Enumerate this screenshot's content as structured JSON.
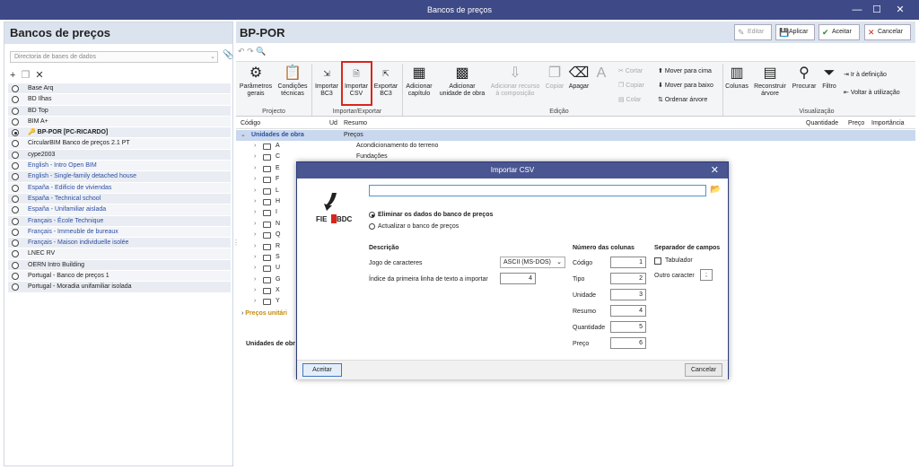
{
  "window": {
    "title": "Bancos de preços",
    "min_icon": "minimize-icon",
    "max_icon": "maximize-icon",
    "close_icon": "close-icon"
  },
  "left": {
    "title": "Bancos de preços",
    "dir_placeholder": "Directoria de bases de dados",
    "databases": [
      {
        "label": "Base Arq",
        "style": "normal",
        "selected": false
      },
      {
        "label": "BD Ilhas",
        "style": "normal",
        "selected": false
      },
      {
        "label": "BD Top",
        "style": "normal",
        "selected": false
      },
      {
        "label": "BIM A+",
        "style": "normal",
        "selected": false
      },
      {
        "label": "BP-POR [PC-RICARDO]",
        "style": "bold",
        "selected": true
      },
      {
        "label": "CircularBIM Banco de preços 2.1 PT",
        "style": "normal",
        "selected": false
      },
      {
        "label": "cype2003",
        "style": "normal",
        "selected": false
      },
      {
        "label": "English - Intro Open BIM",
        "style": "blue",
        "selected": false
      },
      {
        "label": "English - Single-family detached house",
        "style": "blue",
        "selected": false
      },
      {
        "label": "España - Edificio de viviendas",
        "style": "blue",
        "selected": false
      },
      {
        "label": "España - Technical school",
        "style": "blue",
        "selected": false
      },
      {
        "label": "España - Unifamiliar aislada",
        "style": "blue",
        "selected": false
      },
      {
        "label": "Français - École Technique",
        "style": "blue",
        "selected": false
      },
      {
        "label": "Français - Immeuble de bureaux",
        "style": "blue",
        "selected": false
      },
      {
        "label": "Français - Maison individuelle isolée",
        "style": "blue",
        "selected": false
      },
      {
        "label": "LNEC RV",
        "style": "normal",
        "selected": false
      },
      {
        "label": "OERN Intro Building",
        "style": "normal",
        "selected": false
      },
      {
        "label": "Portugal - Banco de preços 1",
        "style": "normal",
        "selected": false
      },
      {
        "label": "Portugal - Moradia unifamiliar isolada",
        "style": "normal",
        "selected": false
      }
    ]
  },
  "right": {
    "title": "BP-POR",
    "buttons": {
      "edit": "Editar",
      "apply": "Aplicar",
      "accept": "Aceitar",
      "cancel": "Cancelar"
    },
    "ribbon": {
      "params": "Parâmetros gerais",
      "conds": "Condições técnicas",
      "imp_bc3": "Importar BC3",
      "imp_csv": "Importar CSV",
      "exp_bc3": "Exportar BC3",
      "add_cap": "Adicionar capítulo",
      "add_unit": "Adicionar unidade de obra",
      "add_res": "Adicionar recurso à composição",
      "copy": "Copiar",
      "delete": "Apagar",
      "cut": "Cortar",
      "copy2": "Copiar",
      "paste": "Colar",
      "up": "Mover para cima",
      "down": "Mover para baixo",
      "sort": "Ordenar árvore",
      "cols": "Colunas",
      "rebuild": "Reconstruir árvore",
      "search": "Procurar",
      "filter": "Filtro",
      "goto": "Ir à definição",
      "back": "Voltar à utilização",
      "grp_proj": "Projecto",
      "grp_io": "Importar/Exportar",
      "grp_edit": "Edição",
      "grp_vis": "Visualização"
    },
    "columns": {
      "code": "Código",
      "ud": "Ud",
      "summary": "Resumo",
      "qty": "Quantidade",
      "price": "Preço",
      "imp": "Importância"
    },
    "tree_root": {
      "label": "Unidades de obra",
      "desc": "Preços"
    },
    "tree": [
      {
        "code": "A",
        "desc": "Acondicionamento do terreno"
      },
      {
        "code": "C",
        "desc": "Fundações"
      },
      {
        "code": "E",
        "desc": ""
      },
      {
        "code": "F",
        "desc": ""
      },
      {
        "code": "L",
        "desc": ""
      },
      {
        "code": "H",
        "desc": ""
      },
      {
        "code": "I",
        "desc": ""
      },
      {
        "code": "N",
        "desc": ""
      },
      {
        "code": "Q",
        "desc": ""
      },
      {
        "code": "R",
        "desc": ""
      },
      {
        "code": "S",
        "desc": ""
      },
      {
        "code": "U",
        "desc": ""
      },
      {
        "code": "G",
        "desc": ""
      },
      {
        "code": "X",
        "desc": ""
      },
      {
        "code": "Y",
        "desc": ""
      }
    ],
    "precos_unit": "Preços unitári",
    "bottom_label": "Unidades de obr"
  },
  "modal": {
    "title": "Importar CSV",
    "path_value": "",
    "opt1": "Eliminar os dados do banco de preços",
    "opt2": "Actualizar o banco de preços",
    "desc_hdr": "Descrição",
    "charset_lbl": "Jogo de caracteres",
    "charset_val": "ASCII (MS-DOS)",
    "firstline_lbl": "Índice da primeira linha de texto a importar",
    "firstline_val": "4",
    "numcol_hdr": "Número das colunas",
    "cols": [
      {
        "label": "Código",
        "val": "1"
      },
      {
        "label": "Tipo",
        "val": "2"
      },
      {
        "label": "Unidade",
        "val": "3"
      },
      {
        "label": "Resumo",
        "val": "4"
      },
      {
        "label": "Quantidade",
        "val": "5"
      },
      {
        "label": "Preço",
        "val": "6"
      }
    ],
    "sep_hdr": "Separador de campos",
    "tab_lbl": "Tabulador",
    "other_lbl": "Outro caracter",
    "other_val": ";",
    "accept": "Aceitar",
    "cancel": "Cancelar",
    "logo_left": "FIE",
    "logo_right": "BDC"
  }
}
